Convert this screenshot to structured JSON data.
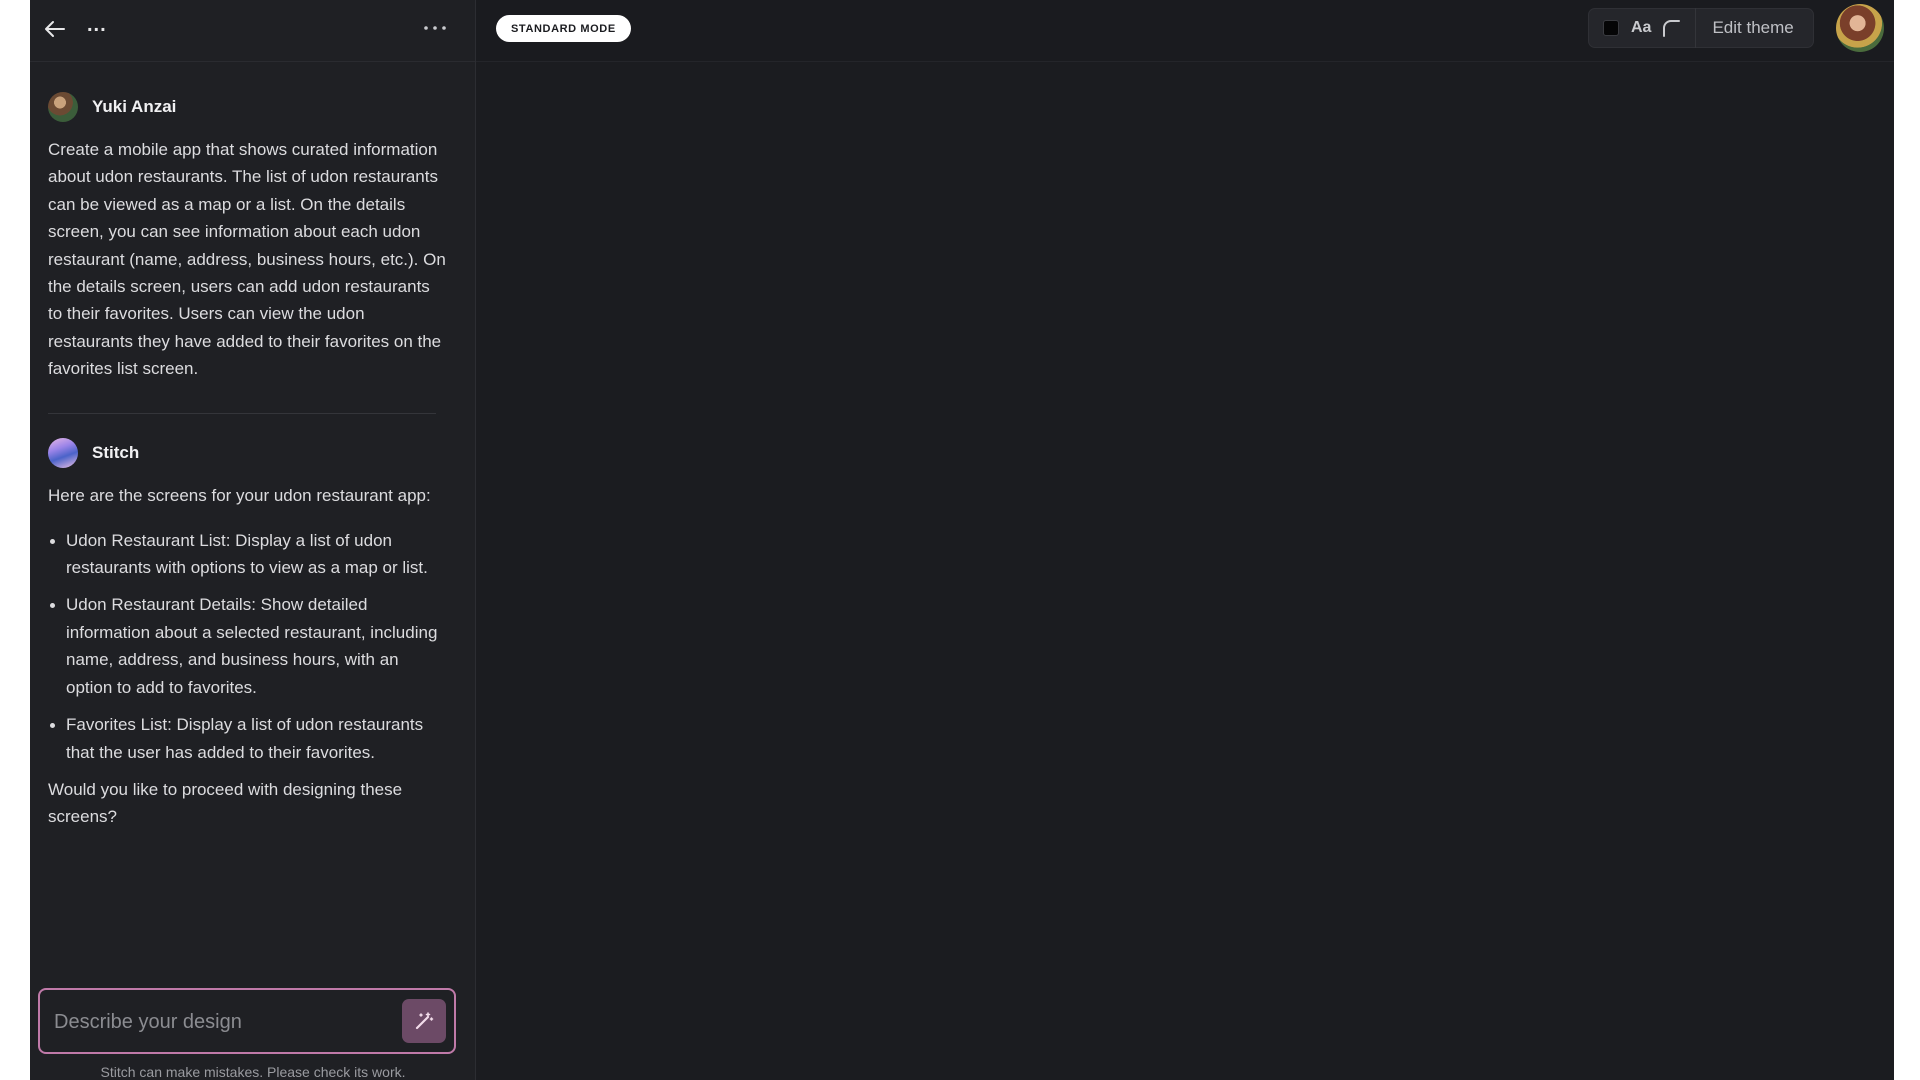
{
  "app": {
    "project_name": "...",
    "mode_badge": "STANDARD MODE",
    "edit_theme_label": "Edit theme",
    "theme_font_label": "Aa",
    "theme_swatch_color": "#050506",
    "accent_color": "#c07aa9"
  },
  "icons": {
    "back": "arrow-left-icon",
    "more": "more-horizontal-icon",
    "corner": "corner-radius-icon",
    "magic": "magic-wand-icon"
  },
  "chat": {
    "user_message": {
      "author": "Yuki Anzai",
      "text": "Create a mobile app that shows curated information about udon restaurants. The list of udon restaurants can be viewed as a map or a list. On the details screen, you can see information about each udon restaurant (name, address, business hours, etc.). On the details screen, users can add udon restaurants to their favorites. Users can view the udon restaurants they have added to their favorites on the favorites list screen."
    },
    "assistant_message": {
      "author": "Stitch",
      "intro": "Here are the screens for your udon restaurant app:",
      "bullets": [
        "Udon Restaurant List: Display a list of udon restaurants with options to view as a map or list.",
        "Udon Restaurant Details: Show detailed information about a selected restaurant, including name, address, and business hours, with an option to add to favorites.",
        "Favorites List: Display a list of udon restaurants that the user has added to their favorites."
      ],
      "question": "Would you like to proceed with designing these screens?"
    }
  },
  "composer": {
    "placeholder": "Describe your design",
    "value": ""
  },
  "disclaimer": "Stitch can make mistakes. Please check its work."
}
